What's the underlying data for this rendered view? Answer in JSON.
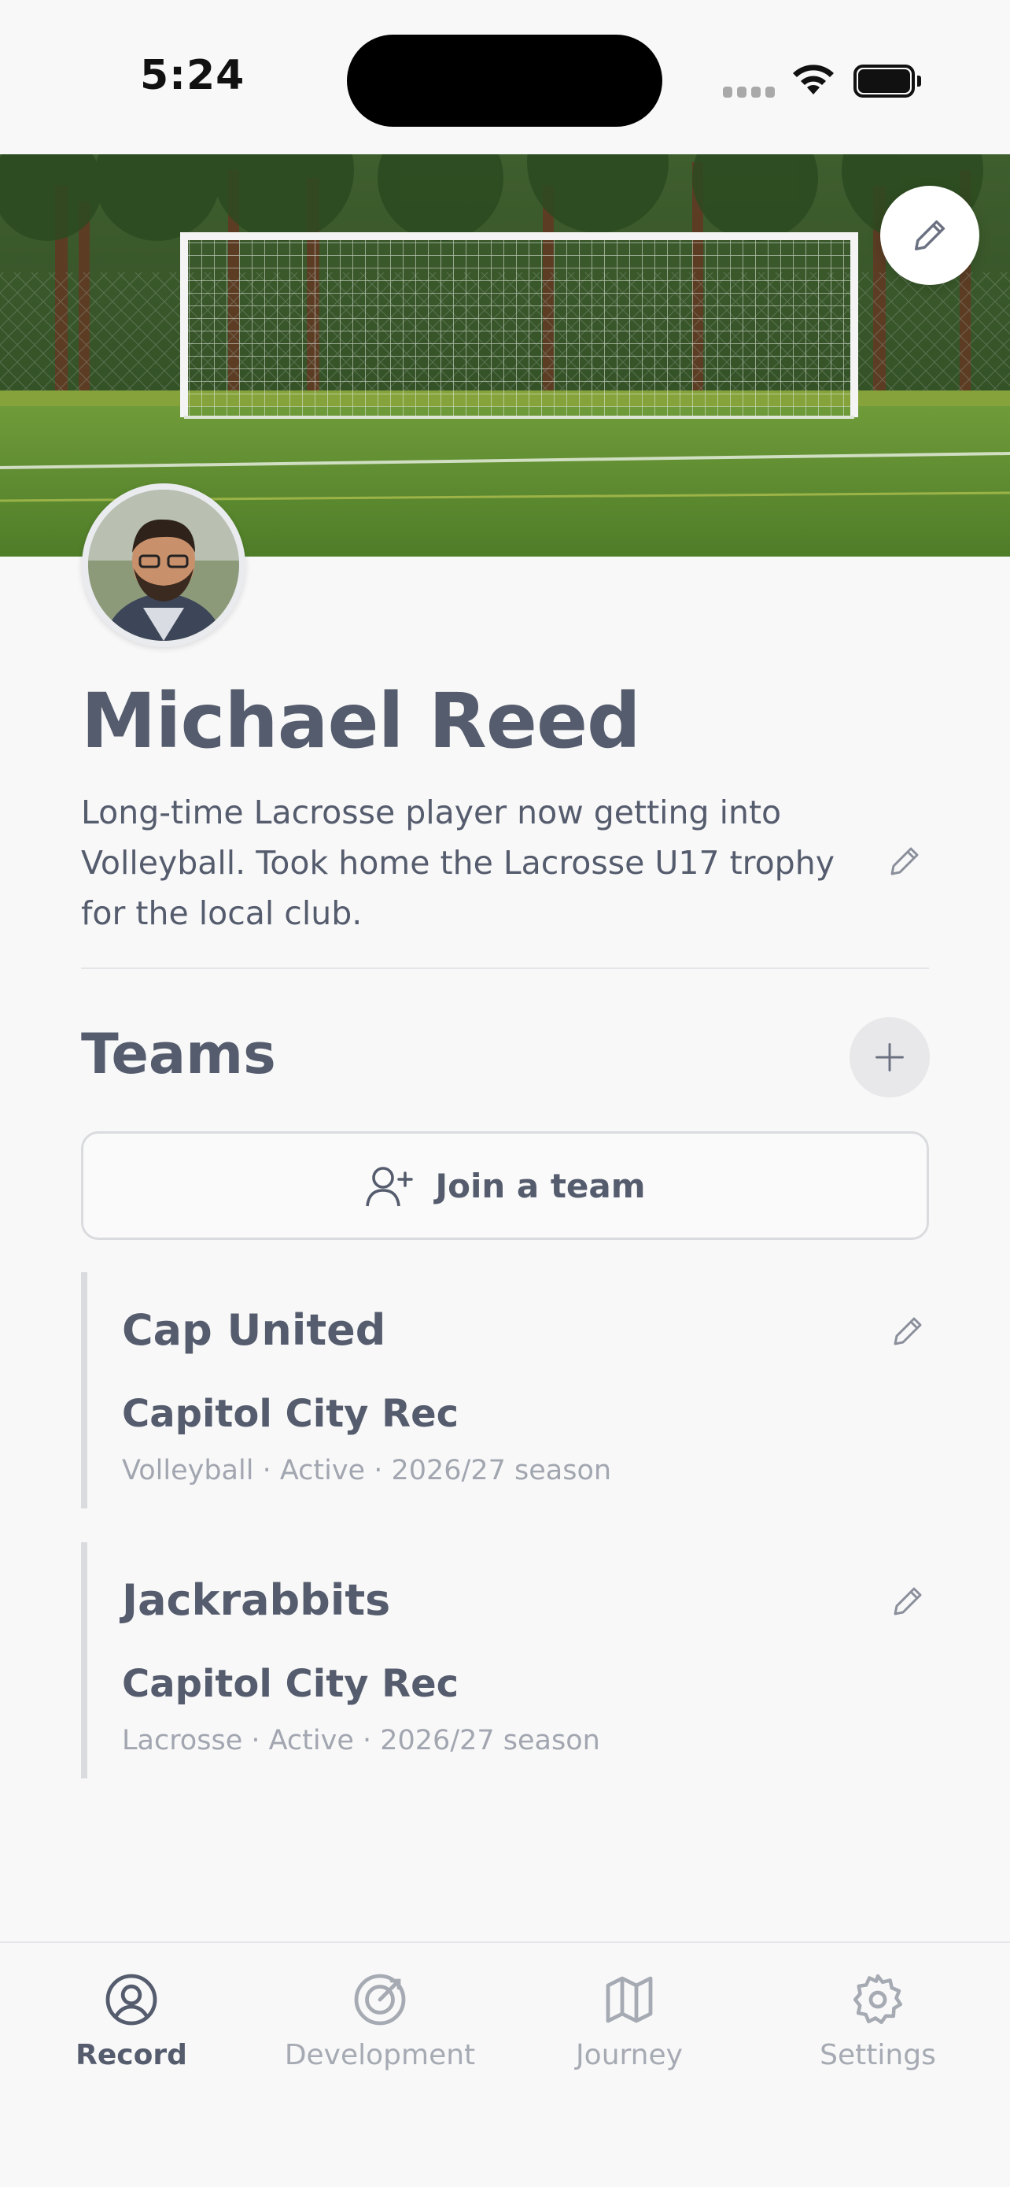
{
  "status_bar": {
    "time": "5:24"
  },
  "profile": {
    "name": "Michael Reed",
    "bio": "Long-time Lacrosse player now getting into Volleyball. Took home the Lacrosse U17 trophy for the local club."
  },
  "teams_section": {
    "heading": "Teams",
    "join_label": "Join a team",
    "teams": [
      {
        "name": "Cap United",
        "org": "Capitol City Rec",
        "meta": "Volleyball · Active · 2026/27 season"
      },
      {
        "name": "Jackrabbits",
        "org": "Capitol City Rec",
        "meta": "Lacrosse · Active · 2026/27 season"
      }
    ]
  },
  "nav": {
    "items": [
      {
        "label": "Record",
        "icon": "user-circle-icon",
        "active": true
      },
      {
        "label": "Development",
        "icon": "target-icon",
        "active": false
      },
      {
        "label": "Journey",
        "icon": "map-icon",
        "active": false
      },
      {
        "label": "Settings",
        "icon": "gear-icon",
        "active": false
      }
    ]
  },
  "colors": {
    "text": "#555c6d",
    "muted": "#a2a6b0",
    "background": "#f8f8f8",
    "accent_border": "#dadbde"
  }
}
